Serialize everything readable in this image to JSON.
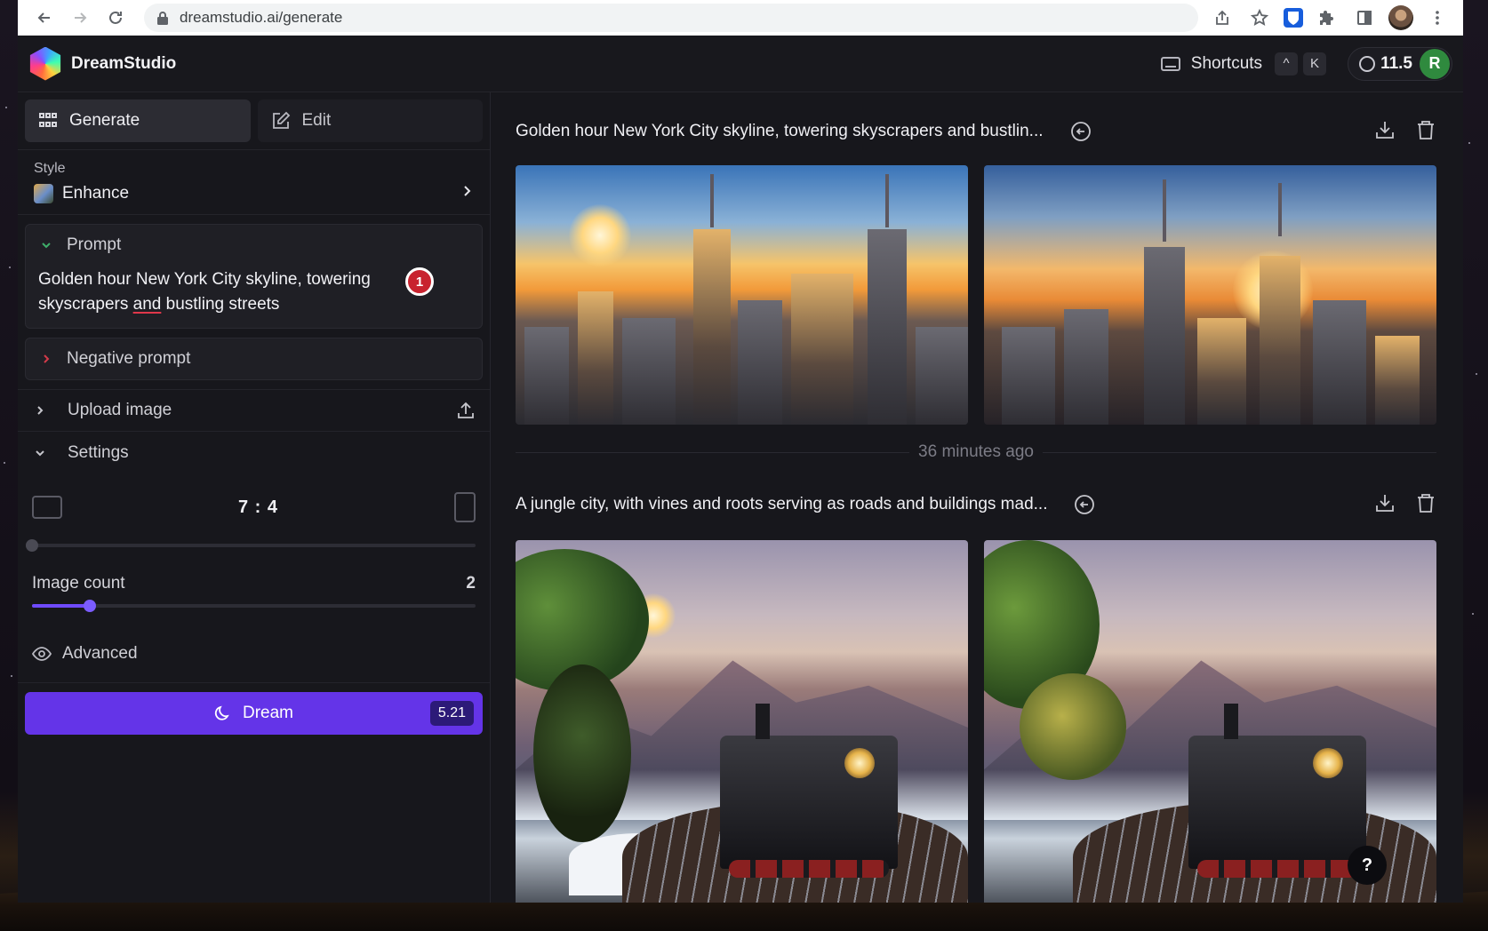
{
  "browser": {
    "url": "dreamstudio.ai/generate"
  },
  "app": {
    "brand": "DreamStudio",
    "shortcuts_label": "Shortcuts",
    "shortcut_keys": [
      "^",
      "K"
    ],
    "credits": "11.5",
    "avatar_initial": "R"
  },
  "sidebar": {
    "tabs": [
      {
        "label": "Generate",
        "icon": "grid-icon",
        "active": true
      },
      {
        "label": "Edit",
        "icon": "edit-icon",
        "active": false
      }
    ],
    "style": {
      "label": "Style",
      "value": "Enhance"
    },
    "prompt": {
      "label": "Prompt",
      "text_before": "Golden hour New York City skyline, towering skyscrapers ",
      "text_underlined": "and",
      "text_after": " bustling streets",
      "issue_count": "1"
    },
    "negative_prompt_label": "Negative prompt",
    "upload_label": "Upload image",
    "settings_label": "Settings",
    "aspect_ratio": "7 : 4",
    "aspect_slider_value": 0,
    "image_count_label": "Image count",
    "image_count": "2",
    "image_count_slider_value": 0.13,
    "advanced_label": "Advanced",
    "dream_label": "Dream",
    "dream_cost": "5.21"
  },
  "main": {
    "generations": [
      {
        "title": "Golden hour New York City skyline, towering skyscrapers and bustlin..."
      },
      {
        "title": "A jungle city, with vines and roots serving as roads and buildings mad..."
      }
    ],
    "separator_time": "36 minutes ago",
    "help_label": "?"
  },
  "colors": {
    "accent": "#6434e8",
    "background": "#17171c",
    "avatar": "#2f8a3e",
    "alert": "#c8232f"
  }
}
